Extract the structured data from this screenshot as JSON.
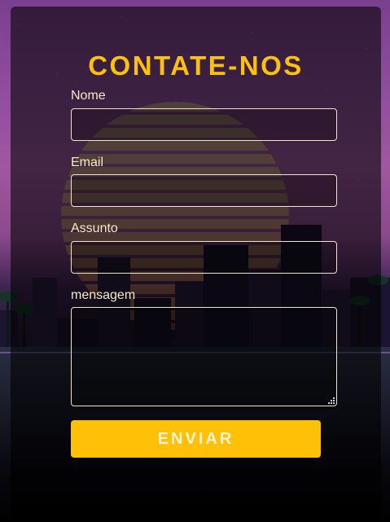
{
  "form": {
    "title": "CONTATE-NOS",
    "fields": [
      {
        "label": "Nome",
        "value": "",
        "placeholder": ""
      },
      {
        "label": "Email",
        "value": "",
        "placeholder": ""
      },
      {
        "label": "Assunto",
        "value": "",
        "placeholder": ""
      },
      {
        "label": "mensagem",
        "value": "",
        "placeholder": ""
      }
    ],
    "submit_label": "ENVIAR"
  },
  "colors": {
    "accent": "#ffc107",
    "label_text": "#f5e9c8",
    "card_overlay": "rgba(0,0,0,0.58)"
  },
  "background": {
    "description_icon": "synthwave-city-sunset-image"
  }
}
